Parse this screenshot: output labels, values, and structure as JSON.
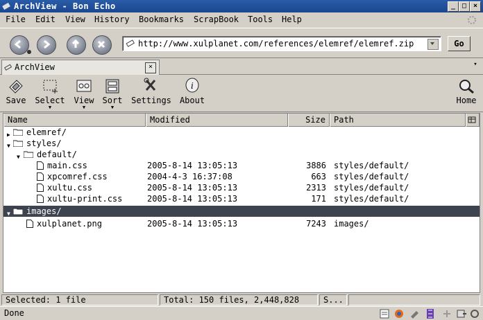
{
  "window": {
    "title": "ArchView - Bon Echo"
  },
  "menu": [
    {
      "label": "File"
    },
    {
      "label": "Edit"
    },
    {
      "label": "View"
    },
    {
      "label": "History"
    },
    {
      "label": "Bookmarks"
    },
    {
      "label": "ScrapBook"
    },
    {
      "label": "Tools"
    },
    {
      "label": "Help"
    }
  ],
  "nav": {
    "url": "http://www.xulplanet.com/references/elemref/elemref.zip",
    "go_label": "Go"
  },
  "tab": {
    "label": "ArchView"
  },
  "toolbar": {
    "save": "Save",
    "select": "Select",
    "view": "View",
    "sort": "Sort",
    "settings": "Settings",
    "about": "About",
    "home": "Home"
  },
  "columns": {
    "name": "Name",
    "modified": "Modified",
    "size": "Size",
    "path": "Path"
  },
  "rows": [
    {
      "name": "elemref/",
      "modified": "",
      "size": "",
      "path": ""
    },
    {
      "name": "styles/",
      "modified": "",
      "size": "",
      "path": ""
    },
    {
      "name": "default/",
      "modified": "",
      "size": "",
      "path": ""
    },
    {
      "name": "main.css",
      "modified": "2005-8-14 13:05:13",
      "size": "3886",
      "path": "styles/default/"
    },
    {
      "name": "xpcomref.css",
      "modified": "2004-4-3 16:37:08",
      "size": "663",
      "path": "styles/default/"
    },
    {
      "name": "xultu.css",
      "modified": "2005-8-14 13:05:13",
      "size": "2313",
      "path": "styles/default/"
    },
    {
      "name": "xultu-print.css",
      "modified": "2005-8-14 13:05:13",
      "size": "171",
      "path": "styles/default/"
    },
    {
      "name": "images/",
      "modified": "",
      "size": "",
      "path": ""
    },
    {
      "name": "xulplanet.png",
      "modified": "2005-8-14 13:05:13",
      "size": "7243",
      "path": "images/"
    }
  ],
  "status": {
    "selected": "Selected: 1 file",
    "total": "Total: 150 files, 2,448,828",
    "s": "S...",
    "done": "Done"
  }
}
